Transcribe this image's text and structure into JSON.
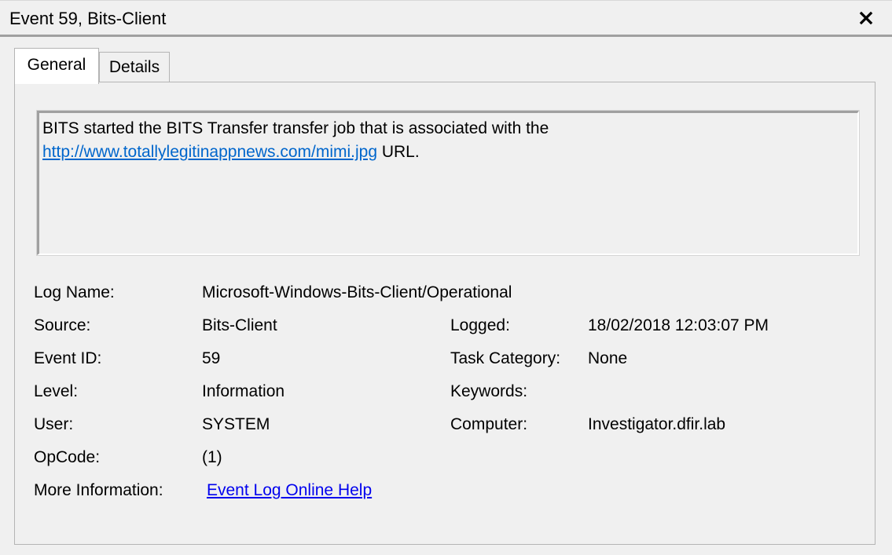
{
  "window": {
    "title": "Event 59, Bits-Client",
    "close_icon": "close-icon"
  },
  "tabs": [
    {
      "label": "General",
      "selected": true
    },
    {
      "label": "Details",
      "selected": false
    }
  ],
  "description": {
    "line1": "BITS started the BITS Transfer transfer job that is associated with the",
    "url": "http://www.totallylegitinappnews.com/mimi.jpg",
    "suffix": " URL."
  },
  "fields": {
    "log_name": {
      "label": "Log Name:",
      "value": "Microsoft-Windows-Bits-Client/Operational"
    },
    "source": {
      "label": "Source:",
      "value": "Bits-Client"
    },
    "logged": {
      "label": "Logged:",
      "value": "18/02/2018 12:03:07 PM"
    },
    "event_id": {
      "label": "Event ID:",
      "value": "59"
    },
    "task_category": {
      "label": "Task Category:",
      "value": "None"
    },
    "level": {
      "label": "Level:",
      "value": "Information"
    },
    "keywords": {
      "label": "Keywords:",
      "value": ""
    },
    "user": {
      "label": "User:",
      "value": "SYSTEM"
    },
    "computer": {
      "label": "Computer:",
      "value": "Investigator.dfir.lab"
    },
    "opcode": {
      "label": "OpCode:",
      "value": "(1)"
    },
    "more_info": {
      "label": "More Information:",
      "link_text": "Event Log Online Help"
    }
  },
  "colors": {
    "background": "#f0f0f0",
    "link": "#0000ee",
    "description_link": "#0066cc"
  }
}
